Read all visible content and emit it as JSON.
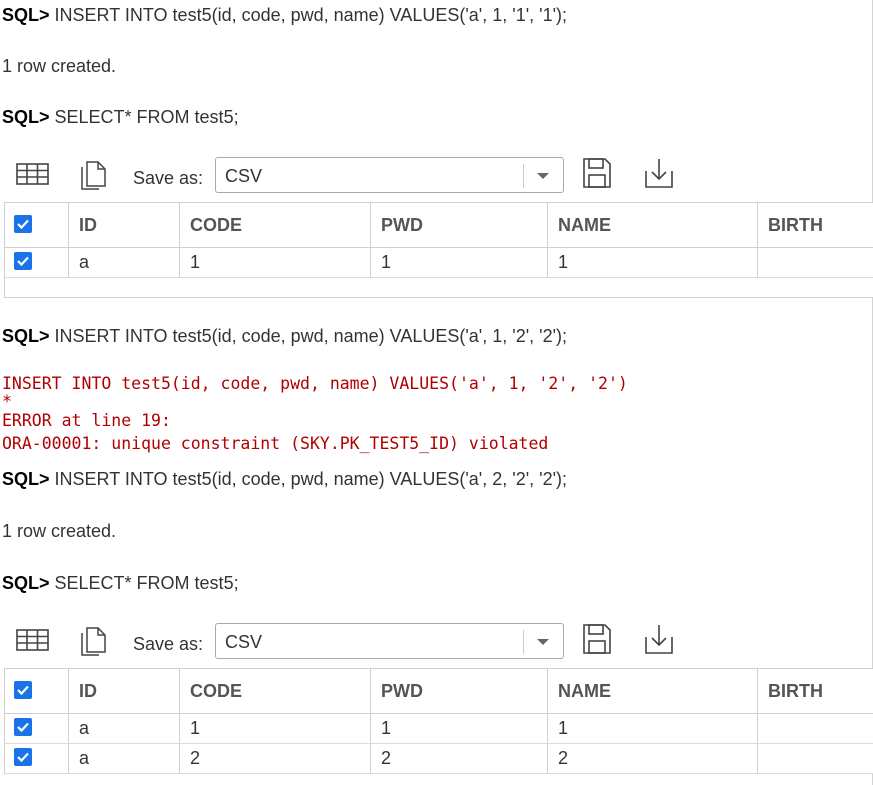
{
  "prompt": "SQL>",
  "stmt1": "INSERT INTO test5(id, code, pwd, name) VALUES('a', 1, '1', '1');",
  "msg1": "1 row created.",
  "stmt2": "SELECT* FROM test5;",
  "grid1": {
    "save_as_label": "Save as:",
    "format": "CSV",
    "columns": [
      "ID",
      "CODE",
      "PWD",
      "NAME",
      "BIRTH"
    ],
    "rows": [
      {
        "id": "a",
        "code": "1",
        "pwd": "1",
        "name": "1",
        "birth": ""
      }
    ]
  },
  "stmt3": "INSERT INTO test5(id, code, pwd, name) VALUES('a', 1, '2', '2');",
  "error": {
    "echo": "INSERT INTO test5(id, code, pwd, name) VALUES('a', 1, '2', '2')",
    "marker": "*",
    "line": "ERROR at line 19:",
    "detail": "ORA-00001: unique constraint (SKY.PK_TEST5_ID) violated"
  },
  "stmt4": "INSERT INTO test5(id, code, pwd, name) VALUES('a', 2, '2', '2');",
  "msg2": "1 row created.",
  "stmt5": "SELECT* FROM test5;",
  "grid2": {
    "save_as_label": "Save as:",
    "format": "CSV",
    "columns": [
      "ID",
      "CODE",
      "PWD",
      "NAME",
      "BIRTH"
    ],
    "rows": [
      {
        "id": "a",
        "code": "1",
        "pwd": "1",
        "name": "1",
        "birth": ""
      },
      {
        "id": "a",
        "code": "2",
        "pwd": "2",
        "name": "2",
        "birth": ""
      }
    ]
  },
  "icons": [
    "grid-view-icon",
    "copy-icon",
    "chevron-down-icon",
    "save-icon",
    "download-icon",
    "checkbox-icon"
  ],
  "colors": {
    "error": "#b00000",
    "checkbox": "#1a73e8"
  }
}
